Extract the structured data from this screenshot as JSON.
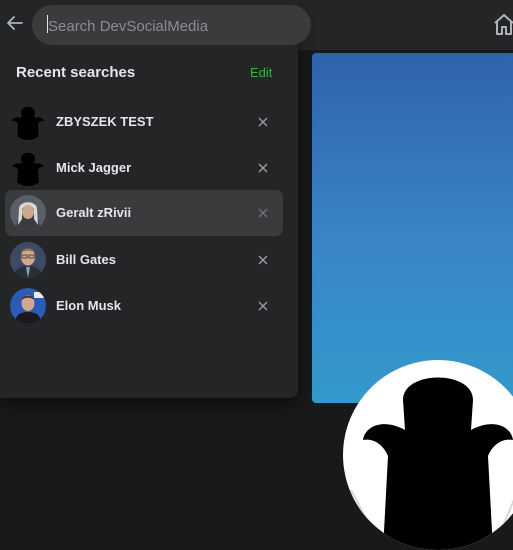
{
  "search": {
    "placeholder": "Search DevSocialMedia",
    "value": ""
  },
  "recent": {
    "title": "Recent searches",
    "edit_label": "Edit"
  },
  "results": [
    {
      "name": "ZBYSZEK TEST",
      "avatar": "silhouette-avatar",
      "active": false
    },
    {
      "name": "Mick Jagger",
      "avatar": "silhouette-avatar",
      "active": false
    },
    {
      "name": "Geralt zRivii",
      "avatar": "geralt-photo",
      "active": true
    },
    {
      "name": "Bill Gates",
      "avatar": "bill-gates-photo",
      "active": false
    },
    {
      "name": "Elon Musk",
      "avatar": "elon-musk-photo",
      "active": false
    }
  ],
  "icons": {
    "back": "arrow-left-icon",
    "remove": "close-icon",
    "home": "home-icon"
  },
  "colors": {
    "panel": "#242526",
    "input": "#3a3b3c",
    "accent": "#3bac4a",
    "cover_top": "#2f63ab",
    "cover_bottom": "#3399cc"
  }
}
